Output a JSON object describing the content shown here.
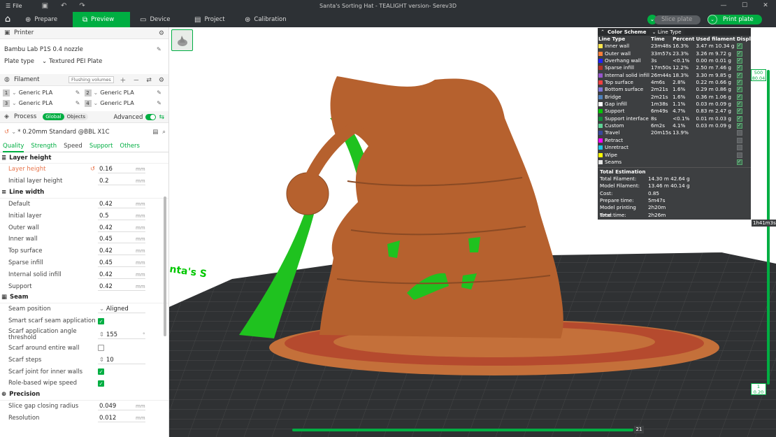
{
  "titlebar": {
    "file_label": "File",
    "title": "Santa's Sorting Hat - TEALIGHT version- Serev3D"
  },
  "nav": {
    "tabs": [
      {
        "label": "Prepare",
        "active": false
      },
      {
        "label": "Preview",
        "active": true
      },
      {
        "label": "Device",
        "active": false
      },
      {
        "label": "Project",
        "active": false
      },
      {
        "label": "Calibration",
        "active": false
      }
    ],
    "slice_label": "Slice plate",
    "print_label": "Print plate"
  },
  "printer": {
    "section_title": "Printer",
    "name": "Bambu Lab P1S 0.4 nozzle",
    "plate_type_label": "Plate type",
    "plate_type_value": "Textured PEI Plate"
  },
  "filament": {
    "section_title": "Filament",
    "flushing_label": "Flushing volumes",
    "items": [
      {
        "num": "1",
        "name": "Generic PLA"
      },
      {
        "num": "2",
        "name": "Generic PLA"
      },
      {
        "num": "3",
        "name": "Generic PLA"
      },
      {
        "num": "4",
        "name": "Generic PLA"
      }
    ]
  },
  "process": {
    "section_title": "Process",
    "seg_global": "Global",
    "seg_objects": "Objects",
    "advanced_label": "Advanced",
    "profile": "* 0.20mm Standard @BBL X1C",
    "tabs": [
      "Quality",
      "Strength",
      "Speed",
      "Support",
      "Others"
    ]
  },
  "params": {
    "layer_height_group": "Layer height",
    "layer_height_label": "Layer height",
    "layer_height_value": "0.16",
    "initial_layer_height_label": "Initial layer height",
    "initial_layer_height_value": "0.2",
    "line_width_group": "Line width",
    "default_label": "Default",
    "default_value": "0.42",
    "initial_layer_label": "Initial layer",
    "initial_layer_value": "0.5",
    "outer_wall_label": "Outer wall",
    "outer_wall_value": "0.42",
    "inner_wall_label": "Inner wall",
    "inner_wall_value": "0.45",
    "top_surface_label": "Top surface",
    "top_surface_value": "0.42",
    "sparse_infill_label": "Sparse infill",
    "sparse_infill_value": "0.45",
    "internal_solid_infill_label": "Internal solid infill",
    "internal_solid_infill_value": "0.42",
    "support_label": "Support",
    "support_value": "0.42",
    "seam_group": "Seam",
    "seam_position_label": "Seam position",
    "seam_position_value": "Aligned",
    "smart_scarf_label": "Smart scarf seam application",
    "scarf_angle_label": "Scarf application angle threshold",
    "scarf_angle_value": "155",
    "scarf_entire_label": "Scarf around entire wall",
    "scarf_steps_label": "Scarf steps",
    "scarf_steps_value": "10",
    "scarf_inner_label": "Scarf joint for inner walls",
    "role_wipe_label": "Role-based wipe speed",
    "precision_group": "Precision",
    "slice_gap_label": "Slice gap closing radius",
    "slice_gap_value": "0.049",
    "resolution_label": "Resolution",
    "resolution_value": "0.012",
    "unit_mm": "mm",
    "unit_deg": "°"
  },
  "legend": {
    "scheme_label": "Color Scheme",
    "scheme_value": "Line Type",
    "headers": [
      "Line Type",
      "Time",
      "Percent",
      "Used filament",
      "Display"
    ],
    "rows": [
      {
        "name": "Inner wall",
        "color": "#ffe64d",
        "time": "23m48s",
        "percent": "16.3%",
        "used": "3.47 m  10.34 g",
        "display": true
      },
      {
        "name": "Outer wall",
        "color": "#ff7d38",
        "time": "33m57s",
        "percent": "23.3%",
        "used": "3.26 m  9.72 g",
        "display": true
      },
      {
        "name": "Overhang wall",
        "color": "#1f1fff",
        "time": "3s",
        "percent": "<0.1%",
        "used": "0.00 m  0.01 g",
        "display": true
      },
      {
        "name": "Sparse infill",
        "color": "#b03029",
        "time": "17m50s",
        "percent": "12.2%",
        "used": "2.50 m  7.46 g",
        "display": true
      },
      {
        "name": "Internal solid infill",
        "color": "#9654cc",
        "time": "26m44s",
        "percent": "18.3%",
        "used": "3.30 m  9.85 g",
        "display": true
      },
      {
        "name": "Top surface",
        "color": "#f03f3f",
        "time": "4m6s",
        "percent": "2.8%",
        "used": "0.22 m  0.66 g",
        "display": true
      },
      {
        "name": "Bottom surface",
        "color": "#7d75d6",
        "time": "2m21s",
        "percent": "1.6%",
        "used": "0.29 m  0.86 g",
        "display": true
      },
      {
        "name": "Bridge",
        "color": "#4d80ba",
        "time": "2m21s",
        "percent": "1.6%",
        "used": "0.36 m  1.06 g",
        "display": true
      },
      {
        "name": "Gap infill",
        "color": "#ffffff",
        "time": "1m38s",
        "percent": "1.1%",
        "used": "0.03 m  0.09 g",
        "display": true
      },
      {
        "name": "Support",
        "color": "#00c700",
        "time": "6m49s",
        "percent": "4.7%",
        "used": "0.83 m  2.47 g",
        "display": true
      },
      {
        "name": "Support interface",
        "color": "#128a39",
        "time": "8s",
        "percent": "<0.1%",
        "used": "0.01 m  0.03 g",
        "display": true
      },
      {
        "name": "Custom",
        "color": "#5ed194",
        "time": "6m2s",
        "percent": "4.1%",
        "used": "0.03 m  0.09 g",
        "display": true
      },
      {
        "name": "Travel",
        "color": "#38489c",
        "time": "20m15s",
        "percent": "13.9%",
        "used": "",
        "display": false
      },
      {
        "name": "Retract",
        "color": "#ff00ff",
        "time": "",
        "percent": "",
        "used": "",
        "display": false
      },
      {
        "name": "Unretract",
        "color": "#1fc2e6",
        "time": "",
        "percent": "",
        "used": "",
        "display": false
      },
      {
        "name": "Wipe",
        "color": "#ffff00",
        "time": "",
        "percent": "",
        "used": "",
        "display": false
      },
      {
        "name": "Seams",
        "color": "#e6e6e6",
        "time": "",
        "percent": "",
        "used": "",
        "display": true
      }
    ],
    "total_title": "Total Estimation",
    "totals": [
      {
        "k": "Total Filament:",
        "v": "14.30 m    42.64 g"
      },
      {
        "k": "Model Filament:",
        "v": "13.46 m    40.14 g"
      },
      {
        "k": "Cost:",
        "v": "0.85"
      },
      {
        "k": "Prepare time:",
        "v": "5m47s"
      },
      {
        "k": "Model printing time:",
        "v": "2h20m"
      },
      {
        "k": "Total time:",
        "v": "2h26m"
      }
    ]
  },
  "layer_slider": {
    "top_layer": "500",
    "top_height": "80.04",
    "bottom_layer": "1",
    "bottom_height": "0.20",
    "time": "1h41m3s"
  },
  "move_slider": {
    "value": "21"
  },
  "plate_text": "nta's S",
  "colors": {
    "accent": "#00ae42",
    "dark": "#2d3135"
  }
}
